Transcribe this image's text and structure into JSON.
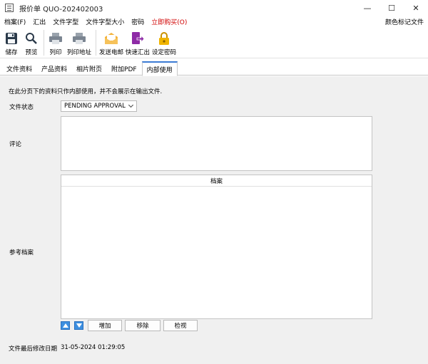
{
  "window": {
    "title": "报价单 QUO-202402003",
    "minimize": "—",
    "maximize": "☐",
    "close": "✕"
  },
  "menu": {
    "items": [
      "档案(F)",
      "汇出",
      "文件字型",
      "文件字型大小",
      "密码",
      "立即购买(O)"
    ],
    "right": "颜色标记文件"
  },
  "toolbar": {
    "save": "储存",
    "preview": "预览",
    "print": "列印",
    "print_address": "列印地址",
    "send_email": "发送电邮",
    "quick_export": "快速汇出",
    "set_password": "设定密码"
  },
  "tabs": [
    "文件资料",
    "产品资料",
    "相片附页",
    "附加PDF",
    "内部使用"
  ],
  "active_tab": 4,
  "form": {
    "note": "在此分页下的资料只作内部使用，并不会展示在输出文件.",
    "status_label": "文件状态",
    "status_value": "PENDING APPROVAL",
    "comment_label": "评论",
    "ref_label": "参考档案",
    "file_header": "档案",
    "add_button": "增加",
    "remove_button": "移除",
    "view_button": "检视",
    "modified_label": "文件最后修改日期",
    "modified_value": "31-05-2024 01:29:05"
  },
  "colors": {
    "accent": "#3b7bd4",
    "buy_red": "#d00000",
    "envelope": "#f3b23a",
    "export_purple": "#8e2ba6",
    "lock_gold": "#f0b400"
  },
  "icons": {
    "save": "floppy-disk-icon",
    "preview": "magnifier-icon",
    "print": "printer-icon",
    "print_address": "printer-icon",
    "send_email": "envelope-icon",
    "quick_export": "export-icon",
    "set_password": "lock-icon"
  }
}
